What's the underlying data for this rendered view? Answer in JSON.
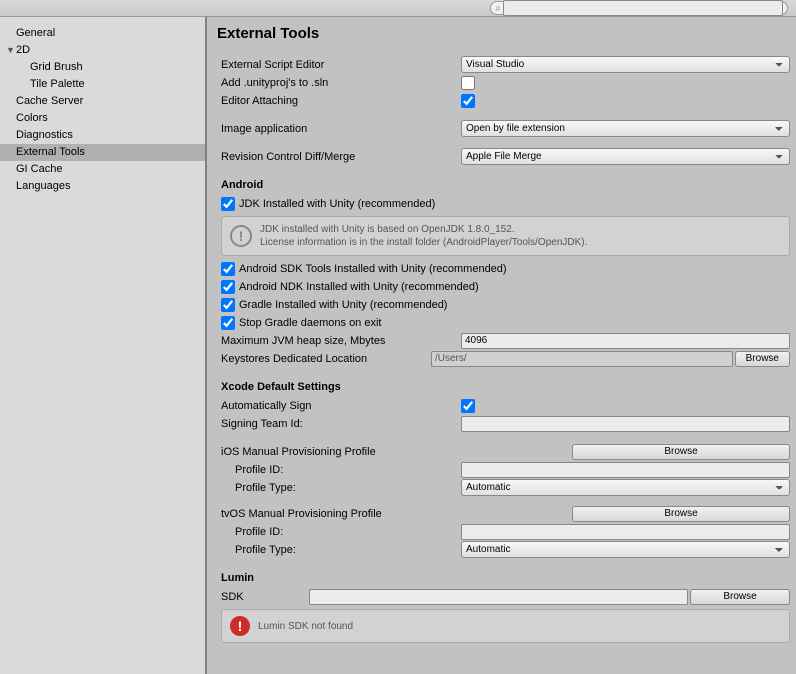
{
  "search": {
    "placeholder": ""
  },
  "sidebar": {
    "items": [
      {
        "label": "General"
      },
      {
        "label": "2D",
        "expandable": true,
        "children": [
          {
            "label": "Grid Brush"
          },
          {
            "label": "Tile Palette"
          }
        ]
      },
      {
        "label": "Cache Server"
      },
      {
        "label": "Colors"
      },
      {
        "label": "Diagnostics"
      },
      {
        "label": "External Tools",
        "selected": true
      },
      {
        "label": "GI Cache"
      },
      {
        "label": "Languages"
      }
    ]
  },
  "title": "External Tools",
  "rows": {
    "scriptEditor": {
      "label": "External Script Editor",
      "value": "Visual Studio"
    },
    "addSln": {
      "label": "Add .unityproj's to .sln",
      "checked": false
    },
    "editorAttach": {
      "label": "Editor Attaching",
      "checked": true
    },
    "imageApp": {
      "label": "Image application",
      "value": "Open by file extension"
    },
    "revCtrl": {
      "label": "Revision Control Diff/Merge",
      "value": "Apple File Merge"
    }
  },
  "android": {
    "header": "Android",
    "jdk": {
      "label": "JDK Installed with Unity (recommended)",
      "checked": true
    },
    "info": {
      "line1": "JDK installed with Unity is based on OpenJDK 1.8.0_152.",
      "line2": "License information is in the install folder (AndroidPlayer/Tools/OpenJDK)."
    },
    "sdk": {
      "label": "Android SDK Tools Installed with Unity (recommended)",
      "checked": true
    },
    "ndk": {
      "label": "Android NDK Installed with Unity (recommended)",
      "checked": true
    },
    "gradle": {
      "label": "Gradle Installed with Unity (recommended)",
      "checked": true
    },
    "stopDaemon": {
      "label": "Stop Gradle daemons on exit",
      "checked": true
    },
    "heap": {
      "label": "Maximum JVM heap size, Mbytes",
      "value": "4096"
    },
    "keystore": {
      "label": "Keystores Dedicated Location",
      "value": "/Users/",
      "button": "Browse"
    }
  },
  "xcode": {
    "header": "Xcode Default Settings",
    "autoSign": {
      "label": "Automatically Sign",
      "checked": true
    },
    "teamId": {
      "label": "Signing Team Id:",
      "value": ""
    },
    "ios": {
      "header": "iOS Manual Provisioning Profile",
      "profileId": {
        "label": "Profile ID:",
        "value": ""
      },
      "profileType": {
        "label": "Profile Type:",
        "value": "Automatic"
      },
      "browse": "Browse"
    },
    "tvos": {
      "header": "tvOS Manual Provisioning Profile",
      "profileId": {
        "label": "Profile ID:",
        "value": ""
      },
      "profileType": {
        "label": "Profile Type:",
        "value": "Automatic"
      },
      "browse": "Browse"
    }
  },
  "lumin": {
    "header": "Lumin",
    "sdk": {
      "label": "SDK",
      "value": "",
      "button": "Browse"
    },
    "error": "Lumin SDK not found"
  }
}
